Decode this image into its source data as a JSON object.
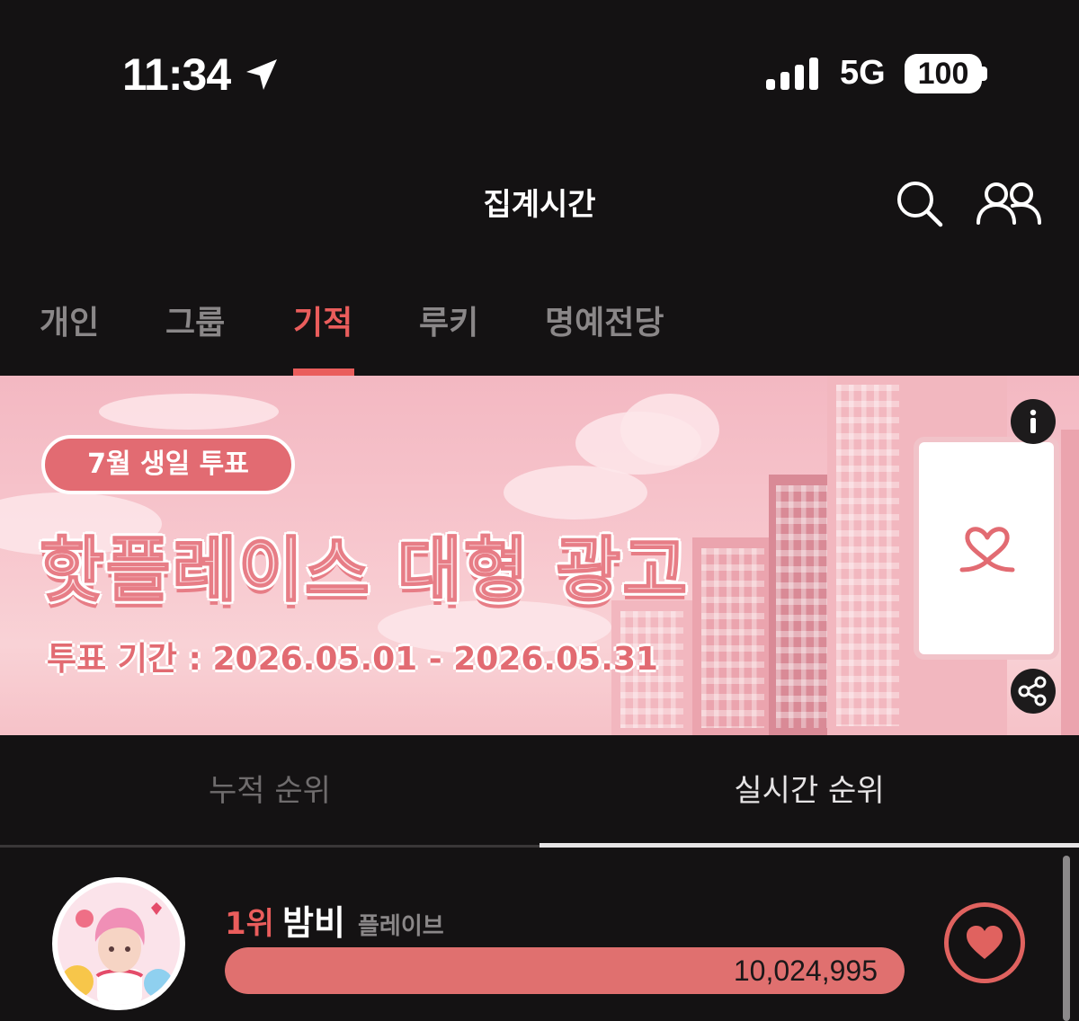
{
  "status_bar": {
    "time": "11:34",
    "network": "5G",
    "battery": "100"
  },
  "header": {
    "title": "집계시간",
    "icons": [
      "search-icon",
      "friends-icon"
    ]
  },
  "tabs": [
    {
      "label": "개인",
      "active": false
    },
    {
      "label": "그룹",
      "active": false
    },
    {
      "label": "기적",
      "active": true
    },
    {
      "label": "루키",
      "active": false
    },
    {
      "label": "명예전당",
      "active": false
    }
  ],
  "banner": {
    "badge": "7월 생일 투표",
    "headline": "핫플레이스 대형 광고",
    "period": "투표 기간 : 2026.05.01 - 2026.05.31",
    "icons": [
      "info-icon",
      "share-icon"
    ]
  },
  "rank_tabs": [
    {
      "label": "누적 순위",
      "active": false
    },
    {
      "label": "실시간 순위",
      "active": true
    }
  ],
  "ranking": [
    {
      "rank": "1위",
      "name": "밤비",
      "group": "플레이브",
      "votes": "10,024,995",
      "bar_fill_fraction": 1.0
    }
  ],
  "colors": {
    "accent": "#ea5d5c",
    "background": "#141213",
    "bar_fill": "#e0706f"
  }
}
